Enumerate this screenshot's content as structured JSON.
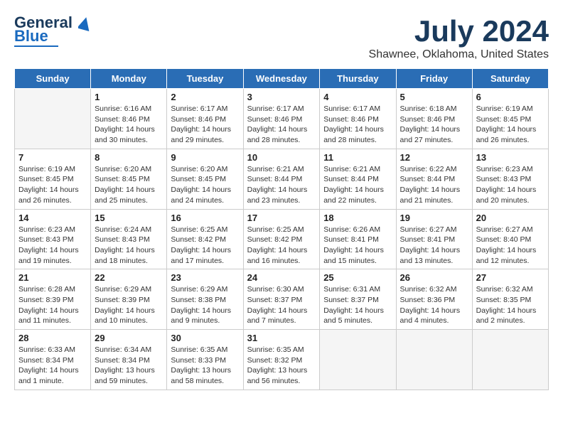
{
  "header": {
    "logo_line1": "General",
    "logo_line2": "Blue",
    "main_title": "July 2024",
    "sub_title": "Shawnee, Oklahoma, United States"
  },
  "days_of_week": [
    "Sunday",
    "Monday",
    "Tuesday",
    "Wednesday",
    "Thursday",
    "Friday",
    "Saturday"
  ],
  "weeks": [
    [
      {
        "day": "",
        "empty": true
      },
      {
        "day": "1",
        "sunrise": "Sunrise: 6:16 AM",
        "sunset": "Sunset: 8:46 PM",
        "daylight": "Daylight: 14 hours and 30 minutes."
      },
      {
        "day": "2",
        "sunrise": "Sunrise: 6:17 AM",
        "sunset": "Sunset: 8:46 PM",
        "daylight": "Daylight: 14 hours and 29 minutes."
      },
      {
        "day": "3",
        "sunrise": "Sunrise: 6:17 AM",
        "sunset": "Sunset: 8:46 PM",
        "daylight": "Daylight: 14 hours and 28 minutes."
      },
      {
        "day": "4",
        "sunrise": "Sunrise: 6:17 AM",
        "sunset": "Sunset: 8:46 PM",
        "daylight": "Daylight: 14 hours and 28 minutes."
      },
      {
        "day": "5",
        "sunrise": "Sunrise: 6:18 AM",
        "sunset": "Sunset: 8:46 PM",
        "daylight": "Daylight: 14 hours and 27 minutes."
      },
      {
        "day": "6",
        "sunrise": "Sunrise: 6:19 AM",
        "sunset": "Sunset: 8:45 PM",
        "daylight": "Daylight: 14 hours and 26 minutes."
      }
    ],
    [
      {
        "day": "7",
        "sunrise": "Sunrise: 6:19 AM",
        "sunset": "Sunset: 8:45 PM",
        "daylight": "Daylight: 14 hours and 26 minutes."
      },
      {
        "day": "8",
        "sunrise": "Sunrise: 6:20 AM",
        "sunset": "Sunset: 8:45 PM",
        "daylight": "Daylight: 14 hours and 25 minutes."
      },
      {
        "day": "9",
        "sunrise": "Sunrise: 6:20 AM",
        "sunset": "Sunset: 8:45 PM",
        "daylight": "Daylight: 14 hours and 24 minutes."
      },
      {
        "day": "10",
        "sunrise": "Sunrise: 6:21 AM",
        "sunset": "Sunset: 8:44 PM",
        "daylight": "Daylight: 14 hours and 23 minutes."
      },
      {
        "day": "11",
        "sunrise": "Sunrise: 6:21 AM",
        "sunset": "Sunset: 8:44 PM",
        "daylight": "Daylight: 14 hours and 22 minutes."
      },
      {
        "day": "12",
        "sunrise": "Sunrise: 6:22 AM",
        "sunset": "Sunset: 8:44 PM",
        "daylight": "Daylight: 14 hours and 21 minutes."
      },
      {
        "day": "13",
        "sunrise": "Sunrise: 6:23 AM",
        "sunset": "Sunset: 8:43 PM",
        "daylight": "Daylight: 14 hours and 20 minutes."
      }
    ],
    [
      {
        "day": "14",
        "sunrise": "Sunrise: 6:23 AM",
        "sunset": "Sunset: 8:43 PM",
        "daylight": "Daylight: 14 hours and 19 minutes."
      },
      {
        "day": "15",
        "sunrise": "Sunrise: 6:24 AM",
        "sunset": "Sunset: 8:43 PM",
        "daylight": "Daylight: 14 hours and 18 minutes."
      },
      {
        "day": "16",
        "sunrise": "Sunrise: 6:25 AM",
        "sunset": "Sunset: 8:42 PM",
        "daylight": "Daylight: 14 hours and 17 minutes."
      },
      {
        "day": "17",
        "sunrise": "Sunrise: 6:25 AM",
        "sunset": "Sunset: 8:42 PM",
        "daylight": "Daylight: 14 hours and 16 minutes."
      },
      {
        "day": "18",
        "sunrise": "Sunrise: 6:26 AM",
        "sunset": "Sunset: 8:41 PM",
        "daylight": "Daylight: 14 hours and 15 minutes."
      },
      {
        "day": "19",
        "sunrise": "Sunrise: 6:27 AM",
        "sunset": "Sunset: 8:41 PM",
        "daylight": "Daylight: 14 hours and 13 minutes."
      },
      {
        "day": "20",
        "sunrise": "Sunrise: 6:27 AM",
        "sunset": "Sunset: 8:40 PM",
        "daylight": "Daylight: 14 hours and 12 minutes."
      }
    ],
    [
      {
        "day": "21",
        "sunrise": "Sunrise: 6:28 AM",
        "sunset": "Sunset: 8:39 PM",
        "daylight": "Daylight: 14 hours and 11 minutes."
      },
      {
        "day": "22",
        "sunrise": "Sunrise: 6:29 AM",
        "sunset": "Sunset: 8:39 PM",
        "daylight": "Daylight: 14 hours and 10 minutes."
      },
      {
        "day": "23",
        "sunrise": "Sunrise: 6:29 AM",
        "sunset": "Sunset: 8:38 PM",
        "daylight": "Daylight: 14 hours and 9 minutes."
      },
      {
        "day": "24",
        "sunrise": "Sunrise: 6:30 AM",
        "sunset": "Sunset: 8:37 PM",
        "daylight": "Daylight: 14 hours and 7 minutes."
      },
      {
        "day": "25",
        "sunrise": "Sunrise: 6:31 AM",
        "sunset": "Sunset: 8:37 PM",
        "daylight": "Daylight: 14 hours and 5 minutes."
      },
      {
        "day": "26",
        "sunrise": "Sunrise: 6:32 AM",
        "sunset": "Sunset: 8:36 PM",
        "daylight": "Daylight: 14 hours and 4 minutes."
      },
      {
        "day": "27",
        "sunrise": "Sunrise: 6:32 AM",
        "sunset": "Sunset: 8:35 PM",
        "daylight": "Daylight: 14 hours and 2 minutes."
      }
    ],
    [
      {
        "day": "28",
        "sunrise": "Sunrise: 6:33 AM",
        "sunset": "Sunset: 8:34 PM",
        "daylight": "Daylight: 14 hours and 1 minute."
      },
      {
        "day": "29",
        "sunrise": "Sunrise: 6:34 AM",
        "sunset": "Sunset: 8:34 PM",
        "daylight": "Daylight: 13 hours and 59 minutes."
      },
      {
        "day": "30",
        "sunrise": "Sunrise: 6:35 AM",
        "sunset": "Sunset: 8:33 PM",
        "daylight": "Daylight: 13 hours and 58 minutes."
      },
      {
        "day": "31",
        "sunrise": "Sunrise: 6:35 AM",
        "sunset": "Sunset: 8:32 PM",
        "daylight": "Daylight: 13 hours and 56 minutes."
      },
      {
        "day": "",
        "empty": true
      },
      {
        "day": "",
        "empty": true
      },
      {
        "day": "",
        "empty": true
      }
    ]
  ]
}
